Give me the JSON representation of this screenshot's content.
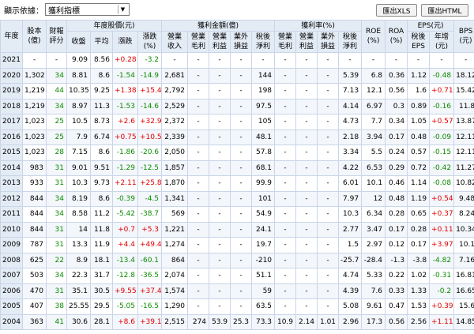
{
  "toolbar": {
    "filter_label": "顯示依據：",
    "selected_metric": "獲利指標",
    "export_xls": "匯出XLS",
    "export_html": "匯出HTML"
  },
  "headers": {
    "year": "年度",
    "capital": "股本\n(億)",
    "rating": "財報\n評分",
    "price_group": "年度股價(元)",
    "price_close": "收盤",
    "price_avg": "平均",
    "price_change": "漲跌",
    "price_change_pct": "漲跌\n(%)",
    "profit_amount_group": "獲利金額(億)",
    "rev": "營業\n收入",
    "gross": "營業\n毛利",
    "op_profit": "營業\n利益",
    "nonop": "業外\n損益",
    "net_after_tax": "稅後\n淨利",
    "profit_rate_group": "獲利率(%)",
    "gross_margin": "營業\n毛利",
    "op_margin": "營業\n利益",
    "nonop_rate": "業外\n損益",
    "net_margin": "稅後\n淨利",
    "roe": "ROE\n(%)",
    "roa": "ROA\n(%)",
    "eps_group": "EPS(元)",
    "eps_after_tax": "稅後\nEPS",
    "eps_growth": "年增\n(元)",
    "bps": "BPS\n(元)"
  },
  "rows": [
    [
      "2021",
      "-",
      "-",
      "9.09",
      "8.56",
      "+0.28",
      "-3.2",
      "-",
      "-",
      "-",
      "-",
      "-",
      "-",
      "-",
      "-",
      "-",
      "-",
      "-",
      "-",
      "-",
      "-"
    ],
    [
      "2020",
      "1,302",
      "34",
      "8.81",
      "8.6",
      "-1.54",
      "-14.9",
      "2,681",
      "-",
      "-",
      "-",
      "144",
      "-",
      "-",
      "-",
      "5.39",
      "6.8",
      "0.36",
      "1.12",
      "-0.48",
      "18.12"
    ],
    [
      "2019",
      "1,219",
      "44",
      "10.35",
      "9.25",
      "+1.38",
      "+15.4",
      "2,792",
      "-",
      "-",
      "-",
      "198",
      "-",
      "-",
      "-",
      "7.13",
      "12.1",
      "0.56",
      "1.6",
      "+0.71",
      "15.42"
    ],
    [
      "2018",
      "1,219",
      "34",
      "8.97",
      "11.3",
      "-1.53",
      "-14.6",
      "2,529",
      "-",
      "-",
      "-",
      "97.5",
      "-",
      "-",
      "-",
      "4.14",
      "6.97",
      "0.3",
      "0.89",
      "-0.16",
      "11.8"
    ],
    [
      "2017",
      "1,023",
      "25",
      "10.5",
      "8.73",
      "+2.6",
      "+32.9",
      "2,372",
      "-",
      "-",
      "-",
      "105",
      "-",
      "-",
      "-",
      "4.73",
      "7.7",
      "0.34",
      "1.05",
      "+0.57",
      "13.87"
    ],
    [
      "2016",
      "1,023",
      "25",
      "7.9",
      "6.74",
      "+0.75",
      "+10.5",
      "2,339",
      "-",
      "-",
      "-",
      "48.1",
      "-",
      "-",
      "-",
      "2.18",
      "3.94",
      "0.17",
      "0.48",
      "-0.09",
      "12.11"
    ],
    [
      "2015",
      "1,023",
      "28",
      "7.15",
      "8.6",
      "-1.86",
      "-20.6",
      "2,050",
      "-",
      "-",
      "-",
      "57.8",
      "-",
      "-",
      "-",
      "3.34",
      "5.5",
      "0.24",
      "0.57",
      "-0.15",
      "12.11"
    ],
    [
      "2014",
      "983",
      "31",
      "9.01",
      "9.51",
      "-1.29",
      "-12.5",
      "1,857",
      "-",
      "-",
      "-",
      "68.1",
      "-",
      "-",
      "-",
      "4.22",
      "6.53",
      "0.29",
      "0.72",
      "-0.42",
      "11.27"
    ],
    [
      "2013",
      "933",
      "31",
      "10.3",
      "9.73",
      "+2.11",
      "+25.8",
      "1,870",
      "-",
      "-",
      "-",
      "99.9",
      "-",
      "-",
      "-",
      "6.01",
      "10.1",
      "0.46",
      "1.14",
      "-0.08",
      "10.82"
    ],
    [
      "2012",
      "844",
      "34",
      "8.19",
      "8.6",
      "-0.39",
      "-4.5",
      "1,341",
      "-",
      "-",
      "-",
      "101",
      "-",
      "-",
      "-",
      "7.97",
      "12",
      "0.48",
      "1.19",
      "+0.54",
      "9.48"
    ],
    [
      "2011",
      "844",
      "34",
      "8.58",
      "11.2",
      "-5.42",
      "-38.7",
      "569",
      "-",
      "-",
      "-",
      "54.9",
      "-",
      "-",
      "-",
      "10.3",
      "6.34",
      "0.28",
      "0.65",
      "+0.37",
      "8.24"
    ],
    [
      "2010",
      "844",
      "31",
      "14",
      "11.8",
      "+0.7",
      "+5.3",
      "1,221",
      "-",
      "-",
      "-",
      "24.1",
      "-",
      "-",
      "-",
      "2.77",
      "3.47",
      "0.17",
      "0.28",
      "+0.11",
      "10.34"
    ],
    [
      "2009",
      "787",
      "31",
      "13.3",
      "11.9",
      "+4.4",
      "+49.4",
      "1,274",
      "-",
      "-",
      "-",
      "19.7",
      "-",
      "-",
      "-",
      "1.5",
      "2.97",
      "0.12",
      "0.17",
      "+3.97",
      "10.1"
    ],
    [
      "2008",
      "625",
      "22",
      "8.9",
      "18.1",
      "-13.4",
      "-60.1",
      "864",
      "-",
      "-",
      "-",
      "-210",
      "-",
      "-",
      "-",
      "-25.7",
      "-28.4",
      "-1.3",
      "-3.8",
      "-4.82",
      "7.16"
    ],
    [
      "2007",
      "503",
      "34",
      "22.3",
      "31.7",
      "-12.8",
      "-36.5",
      "2,074",
      "-",
      "-",
      "-",
      "51.1",
      "-",
      "-",
      "-",
      "4.74",
      "5.33",
      "0.22",
      "1.02",
      "-0.31",
      "16.81"
    ],
    [
      "2006",
      "470",
      "31",
      "35.1",
      "30.5",
      "+9.55",
      "+37.4",
      "1,574",
      "-",
      "-",
      "-",
      "59",
      "-",
      "-",
      "-",
      "4.39",
      "7.6",
      "0.33",
      "1.33",
      "-0.2",
      "16.65"
    ],
    [
      "2005",
      "407",
      "38",
      "25.55",
      "29.5",
      "-5.05",
      "-16.5",
      "1,290",
      "-",
      "-",
      "-",
      "63.5",
      "-",
      "-",
      "-",
      "5.08",
      "9.61",
      "0.47",
      "1.53",
      "+0.39",
      "15.6"
    ],
    [
      "2004",
      "363",
      "41",
      "30.6",
      "28.1",
      "+8.6",
      "+39.1",
      "2,515",
      "274",
      "53.9",
      "25.3",
      "73.3",
      "10.9",
      "2.14",
      "1.01",
      "2.96",
      "17.3",
      "0.56",
      "2.56",
      "+1.11",
      "14.85"
    ]
  ],
  "colors": {
    "header_bg": "#e3ebf5",
    "green": "#0a8a00",
    "red": "#e00000",
    "alt_row": "#f3f6fb"
  }
}
